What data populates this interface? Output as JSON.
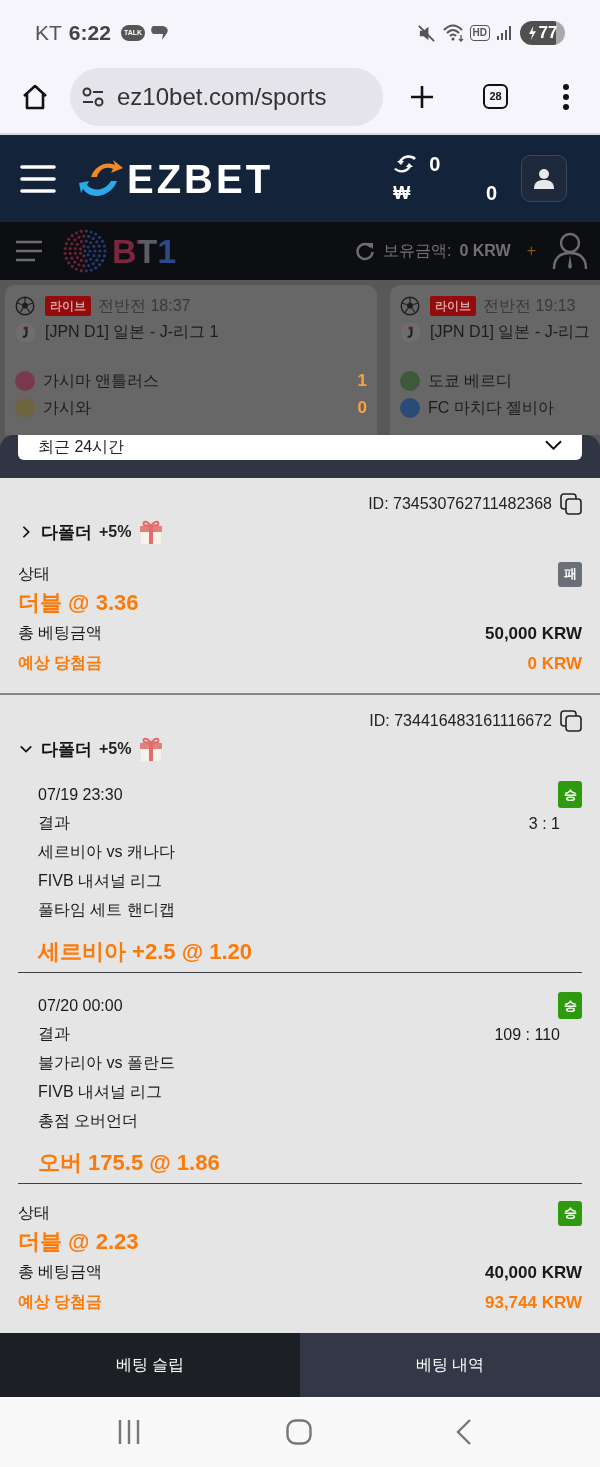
{
  "status_bar": {
    "carrier": "KT",
    "time": "6:22",
    "talk_badge": "TALK",
    "hd_badge": "HD",
    "battery": "77"
  },
  "browser": {
    "url": "ez10bet.com/sports",
    "tab_count": "28"
  },
  "site_header": {
    "logo": "EZBET",
    "points_balance": "0",
    "currency_symbol": "₩",
    "cash_balance": "0"
  },
  "app_header": {
    "logo": "BT1",
    "balance_label": "보유금액:",
    "balance": "0 KRW",
    "deposit": "+"
  },
  "live_matches": [
    {
      "badge": "라이브",
      "clock": "전반전 18:37",
      "league": "[JPN D1] 일본 - J-리그 1",
      "teams": [
        {
          "name": "가시마 앤틀러스",
          "score": "1",
          "color": "#7a3a4e"
        },
        {
          "name": "가시와",
          "score": "0",
          "color": "#6e6440"
        }
      ]
    },
    {
      "badge": "라이브",
      "clock": "전반전 19:13",
      "league": "[JPN D1] 일본 - J-리그",
      "teams": [
        {
          "name": "도쿄 베르디",
          "color": "#3e5a3a"
        },
        {
          "name": "FC 마치다 젤비아",
          "color": "#2c4a78"
        }
      ]
    }
  ],
  "bet_history": {
    "period": "최근 24시간",
    "bets": [
      {
        "id": "ID: 734530762711482368",
        "type": "다폴더",
        "bonus": "+5%",
        "expanded": false,
        "status_label": "상태",
        "result": {
          "label": "패",
          "kind": "loss"
        },
        "bet_line": "더블 @ 3.36",
        "stake_label": "총 베팅금액",
        "stake": "50,000 KRW",
        "payout_label": "예상 당첨금",
        "payout": "0 KRW"
      },
      {
        "id": "ID: 734416483161116672",
        "type": "다폴더",
        "bonus": "+5%",
        "expanded": true,
        "selections": [
          {
            "datetime": "07/19 23:30",
            "result": {
              "label": "승",
              "kind": "win"
            },
            "score_label": "결과",
            "score": "3 : 1",
            "match": "세르비아 vs 캐나다",
            "league": "FIVB 내셔널 리그",
            "market": "풀타임 세트 핸디캡",
            "pick": "세르비아 +2.5 @ 1.20"
          },
          {
            "datetime": "07/20 00:00",
            "result": {
              "label": "승",
              "kind": "win"
            },
            "score_label": "결과",
            "score": "109 : 110",
            "match": "불가리아 vs 폴란드",
            "league": "FIVB 내셔널 리그",
            "market": "총점 오버언더",
            "pick": "오버 175.5 @ 1.86"
          }
        ],
        "status_label": "상태",
        "result": {
          "label": "승",
          "kind": "win"
        },
        "bet_line": "더블 @ 2.23",
        "stake_label": "총 베팅금액",
        "stake": "40,000 KRW",
        "payout_label": "예상 당첨금",
        "payout": "93,744 KRW"
      }
    ]
  },
  "bottom_tabs": [
    {
      "label": "베팅 슬립",
      "selected": false
    },
    {
      "label": "베팅 내역",
      "selected": true
    }
  ]
}
